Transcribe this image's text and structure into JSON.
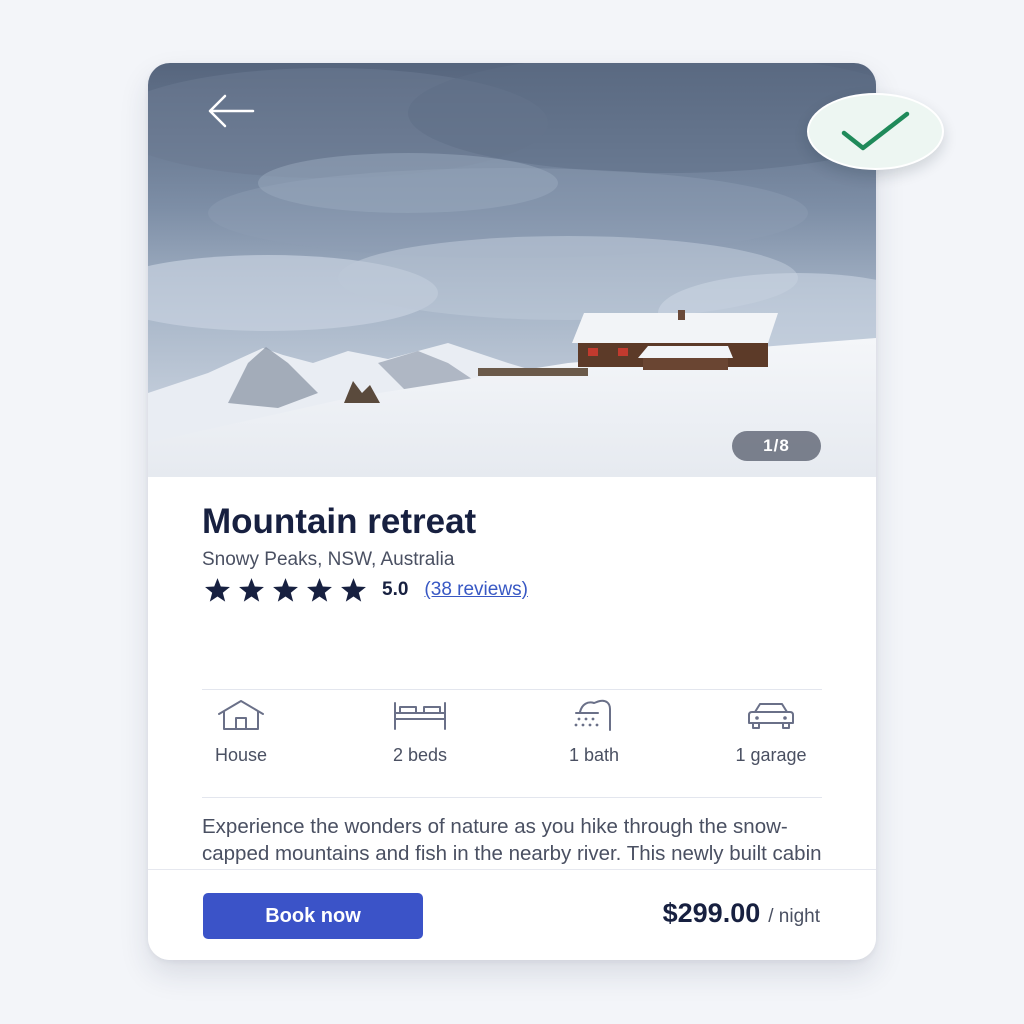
{
  "hero": {
    "counter": "1/8"
  },
  "listing": {
    "title": "Mountain retreat",
    "location": "Snowy Peaks, NSW, Australia",
    "rating": "5.0",
    "reviews": "(38 reviews)",
    "star_count": 5,
    "star_color": "#172040"
  },
  "features": [
    {
      "icon": "house-icon",
      "label": "House"
    },
    {
      "icon": "bed-icon",
      "label": "2 beds"
    },
    {
      "icon": "shower-icon",
      "label": "1 bath"
    },
    {
      "icon": "car-icon",
      "label": "1 garage"
    }
  ],
  "description": "Experience the wonders of nature as you hike through the snow-capped mountains and fish in the nearby river. This newly built cabin is perched high in the mountains with beautiful",
  "footer": {
    "book_label": "Book now",
    "price": "$299.00",
    "per_night": "/ night"
  },
  "colors": {
    "accent": "#3b53c8",
    "text_dark": "#172040",
    "check_green": "#1f8a5a"
  }
}
